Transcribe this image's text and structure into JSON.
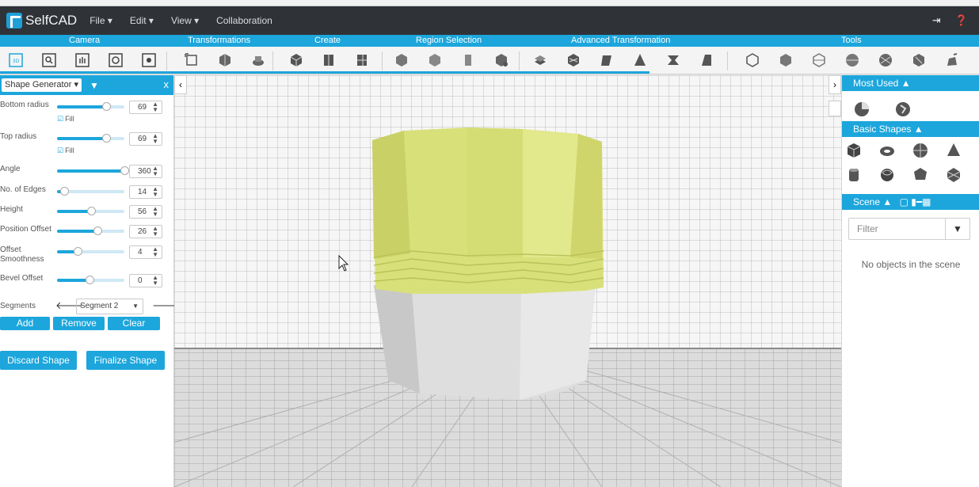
{
  "app": {
    "name": "SelfCAD"
  },
  "menu": [
    {
      "label": "File ▾"
    },
    {
      "label": "Edit ▾"
    },
    {
      "label": "View ▾"
    },
    {
      "label": "Collaboration"
    }
  ],
  "categories": [
    "Camera",
    "Transformations",
    "Create",
    "Region Selection",
    "Advanced Transformation",
    "Tools"
  ],
  "left_panel": {
    "title": "Shape Generator ▾",
    "params": [
      {
        "label": "Bottom radius",
        "value": "69",
        "fill_label": "Fill",
        "level": 0.73
      },
      {
        "label": "Top radius",
        "value": "69",
        "fill_label": "Fill",
        "level": 0.73
      },
      {
        "label": "Angle",
        "value": "360",
        "level": 1.0
      },
      {
        "label": "No. of Edges",
        "value": "14",
        "level": 0.1
      },
      {
        "label": "Height",
        "value": "56",
        "level": 0.5
      },
      {
        "label": "Position Offset",
        "value": "26",
        "level": 0.6
      },
      {
        "label": "Offset Smoothness",
        "value": "4",
        "level": 0.3
      },
      {
        "label": "Bevel Offset",
        "value": "0",
        "level": 0.48
      }
    ],
    "segments_label": "Segments",
    "segment_selected": "Segment 2",
    "buttons": {
      "add": "Add",
      "remove": "Remove",
      "clear": "Clear",
      "discard": "Discard Shape",
      "finalize": "Finalize Shape"
    }
  },
  "right_panel": {
    "most_used": "Most Used",
    "basic_shapes": "Basic Shapes",
    "scene": "Scene",
    "filter_placeholder": "Filter",
    "empty_text": "No objects in the scene"
  },
  "colors": {
    "accent": "#1ca6dc",
    "header": "#2f3338",
    "shape_top": "#d8e07a",
    "shape_bottom": "#dedede"
  }
}
